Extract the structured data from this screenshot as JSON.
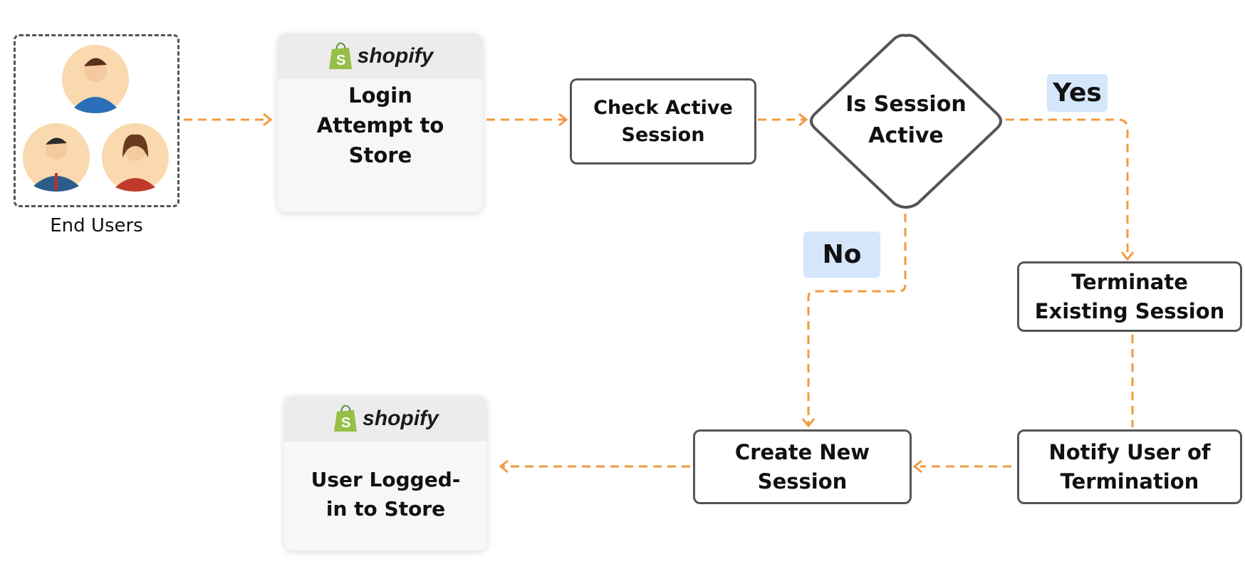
{
  "colors": {
    "arrow": "#f39a3c",
    "border": "#555555",
    "tag_bg": "#d5e6fb",
    "shopify_green": "#95bf47"
  },
  "end_users": {
    "label": "End Users"
  },
  "shopify_logo_text": "shopify",
  "nodes": {
    "login": "Login Attempt to Store",
    "check": "Check Active Session",
    "decision": "Is Session Active",
    "terminate": "Terminate Existing Session",
    "notify": "Notify User of Termination",
    "create": "Create New Session",
    "logged_in": "User Logged-in to Store"
  },
  "labels": {
    "yes": "Yes",
    "no": "No"
  }
}
